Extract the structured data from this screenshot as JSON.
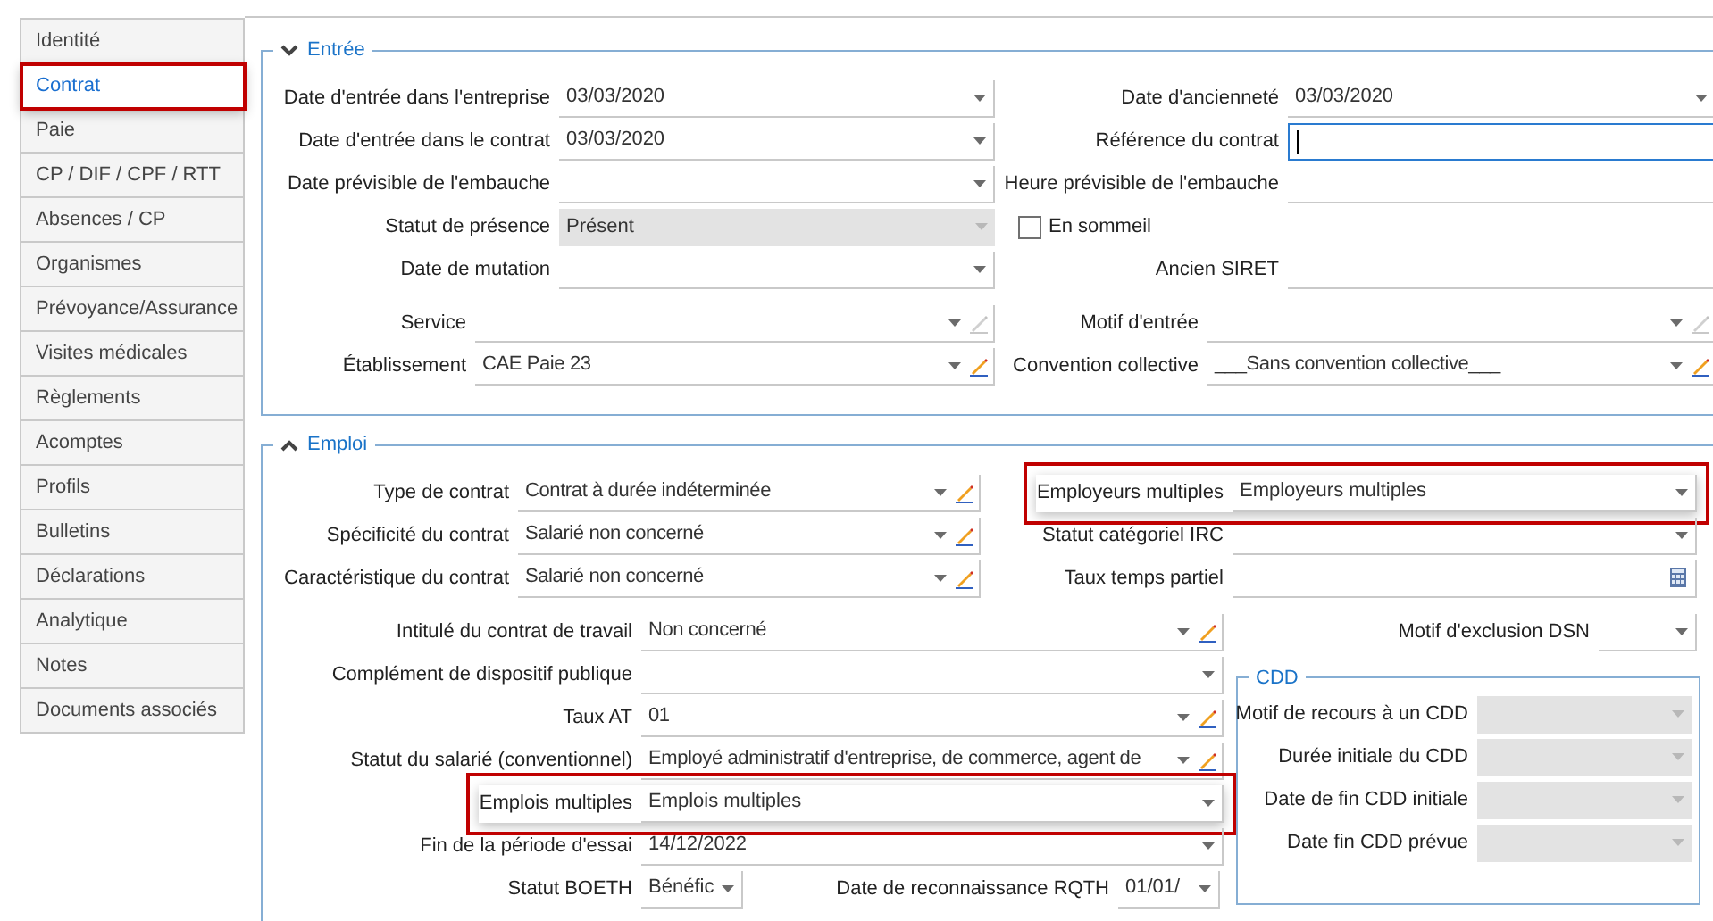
{
  "sidebar": {
    "items": [
      {
        "label": "Identité",
        "selected": false,
        "highlighted": false
      },
      {
        "label": "Contrat",
        "selected": true,
        "highlighted": true
      },
      {
        "label": "Paie",
        "selected": false,
        "highlighted": false
      },
      {
        "label": "CP / DIF / CPF / RTT",
        "selected": false,
        "highlighted": false
      },
      {
        "label": "Absences / CP",
        "selected": false,
        "highlighted": false
      },
      {
        "label": "Organismes",
        "selected": false,
        "highlighted": false
      },
      {
        "label": "Prévoyance/Assurance",
        "selected": false,
        "highlighted": false
      },
      {
        "label": "Visites médicales",
        "selected": false,
        "highlighted": false
      },
      {
        "label": "Règlements",
        "selected": false,
        "highlighted": false
      },
      {
        "label": "Acomptes",
        "selected": false,
        "highlighted": false
      },
      {
        "label": "Profils",
        "selected": false,
        "highlighted": false
      },
      {
        "label": "Bulletins",
        "selected": false,
        "highlighted": false
      },
      {
        "label": "Déclarations",
        "selected": false,
        "highlighted": false
      },
      {
        "label": "Analytique",
        "selected": false,
        "highlighted": false
      },
      {
        "label": "Notes",
        "selected": false,
        "highlighted": false
      },
      {
        "label": "Documents associés",
        "selected": false,
        "highlighted": false
      }
    ]
  },
  "entree": {
    "title": "Entrée",
    "chevron_up": false,
    "rows_a": [
      {
        "left": {
          "label": "Date d'entrée dans l'entreprise",
          "kind": "select",
          "value": "03/03/2020"
        },
        "right": {
          "label": "Date d'ancienneté",
          "kind": "select",
          "value": "03/03/2020"
        }
      },
      {
        "left": {
          "label": "Date d'entrée dans le contrat",
          "kind": "select",
          "value": "03/03/2020"
        },
        "right": {
          "label": "Référence du contrat",
          "kind": "text",
          "focused": true
        }
      },
      {
        "left": {
          "label": "Date prévisible de l'embauche",
          "kind": "select"
        },
        "right": {
          "label": "Heure prévisible de l'embauche",
          "kind": "text",
          "focused": false
        }
      },
      {
        "left": {
          "label": "Statut de présence",
          "kind": "disabled_select",
          "value": "Présent"
        },
        "right": {
          "label": "En sommeil",
          "kind": "checkbox",
          "checked": false
        }
      },
      {
        "left": {
          "label": "Date de mutation",
          "kind": "select"
        },
        "right": {
          "label": "Ancien SIRET",
          "kind": "text",
          "focused": false
        }
      }
    ],
    "rows_b": [
      {
        "left": {
          "label": "Service",
          "kind": "select_edit",
          "edit_enabled": false
        },
        "right": {
          "label": "Motif d'entrée",
          "kind": "select_edit",
          "edit_enabled": false
        }
      },
      {
        "left": {
          "label": "Établissement",
          "kind": "select_edit",
          "value": "CAE Paie 23",
          "edit_enabled": true
        },
        "right": {
          "label": "Convention collective",
          "kind": "select_edit",
          "value": "___Sans convention collective___",
          "edit_enabled": true
        }
      }
    ]
  },
  "emploi": {
    "title": "Emploi",
    "chevron_up": true,
    "rows_a": [
      {
        "left": {
          "label": "Type de contrat",
          "kind": "select_edit",
          "value": "Contrat à durée indéterminée",
          "edit_enabled": true,
          "highlighted": false
        },
        "right": {
          "label": "Employeurs multiples",
          "kind": "select",
          "value": "Employeurs multiples",
          "highlighted": true
        }
      },
      {
        "left": {
          "label": "Spécificité du contrat",
          "kind": "select_edit",
          "value": "Salarié non concerné",
          "edit_enabled": true,
          "highlighted": false
        },
        "right": {
          "label": "Statut catégoriel IRC",
          "kind": "select",
          "highlighted": false
        }
      },
      {
        "left": {
          "label": "Caractéristique du contrat",
          "kind": "select_edit",
          "value": "Salarié non concerné",
          "edit_enabled": true,
          "highlighted": false
        },
        "right": {
          "label": "Taux temps partiel",
          "kind": "calc",
          "highlighted": false
        }
      }
    ],
    "rows_b": [
      {
        "label": "Intitulé du contrat de travail",
        "kind": "select_edit",
        "value": "Non concerné",
        "edit_enabled": true,
        "highlighted": false
      },
      {
        "label": "Complément de dispositif publique",
        "kind": "select",
        "highlighted": false
      },
      {
        "label": "Taux AT",
        "kind": "select_edit",
        "value": "01",
        "edit_enabled": true,
        "highlighted": false
      },
      {
        "label": "Statut du salarié (conventionnel)",
        "kind": "select_edit",
        "value": "Employé administratif d'entreprise, de commerce, agent de",
        "edit_enabled": true,
        "highlighted": false
      },
      {
        "label": "Emplois multiples",
        "kind": "select",
        "value": "Emplois multiples",
        "highlighted": true
      },
      {
        "label": "Fin de la période d'essai",
        "kind": "select",
        "value": "14/12/2022",
        "highlighted": false
      }
    ],
    "boeth": [
      {
        "label": "Statut BOETH",
        "kind": "select",
        "value": "Bénéfic",
        "highlighted": false
      },
      {
        "label": "Date de reconnaissance RQTH",
        "kind": "select",
        "value": "01/01/",
        "highlighted": false
      }
    ],
    "exclusion": {
      "label": "Motif d'exclusion DSN",
      "kind": "select",
      "highlighted": false
    },
    "cdd": {
      "title": "CDD",
      "fields": [
        {
          "label": "Motif de recours à un CDD",
          "kind": "disabled_select",
          "highlighted": false
        },
        {
          "label": "Durée initiale du CDD",
          "kind": "disabled_select",
          "highlighted": false
        },
        {
          "label": "Date de fin CDD initiale",
          "kind": "disabled_select",
          "highlighted": false
        },
        {
          "label": "Date fin CDD prévue",
          "kind": "disabled_select",
          "highlighted": false
        }
      ]
    }
  }
}
